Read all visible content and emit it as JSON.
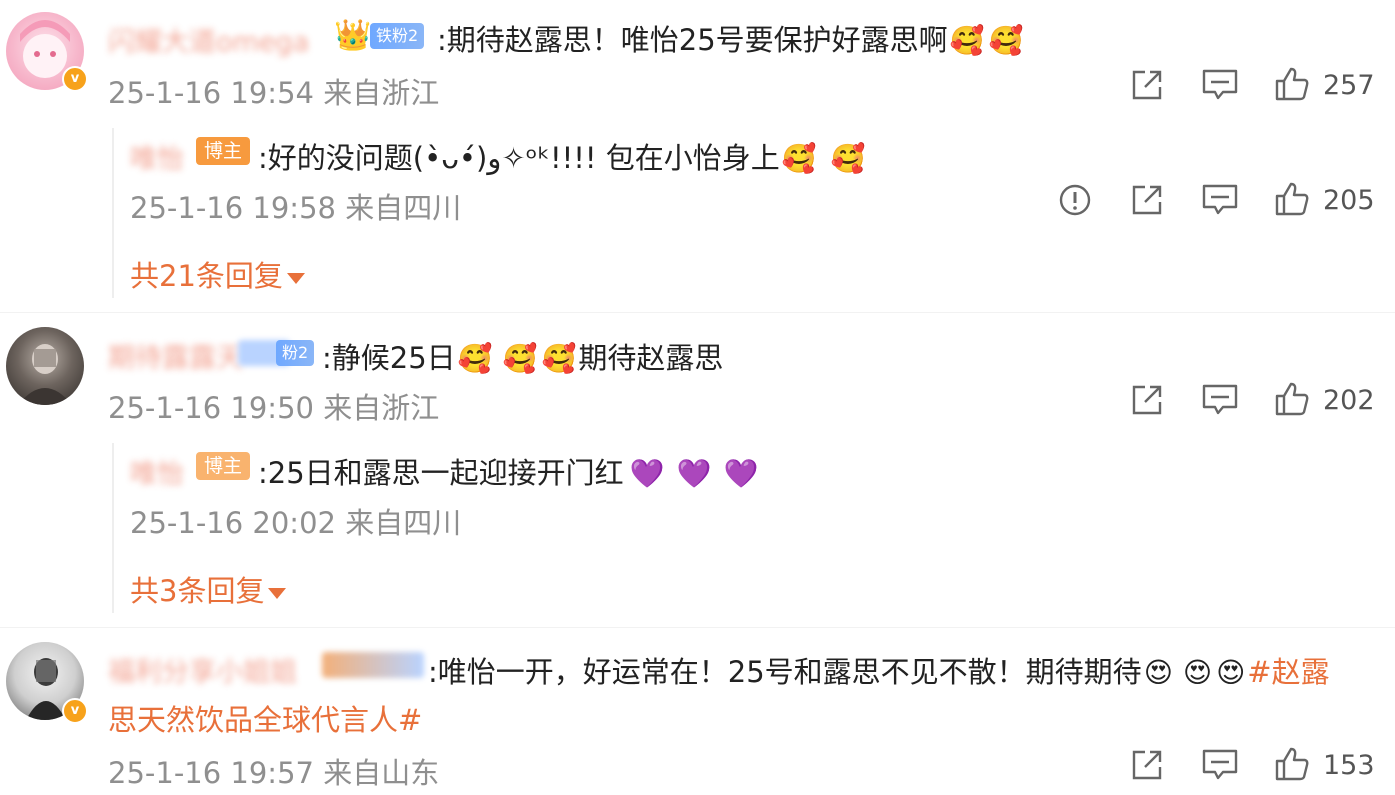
{
  "comments": [
    {
      "username": "闪耀大道omega",
      "fan_badge": "铁粉2",
      "text": ":期待赵露思！唯怡25号要保护好露思啊",
      "emojis": [
        "🥰",
        "🥰"
      ],
      "time": "25-1-16 19:54 来自浙江",
      "likes": "257",
      "reply": {
        "username": "唯怡",
        "badge": "博主",
        "text": ":好的没问题(•̀ᴗ•́)و✧ᵒᵏ!!!! 包在小怡身上",
        "emojis": [
          "🥰",
          "🥰"
        ],
        "time": "25-1-16 19:58 来自四川",
        "likes": "205"
      },
      "more_replies": "共21条回复"
    },
    {
      "username": "期待露露天",
      "fan_badge": "粉2",
      "text": ":静候25日",
      "emojis": [
        "🥰",
        "🥰",
        "🥰"
      ],
      "text_after": "期待赵露思",
      "time": "25-1-16 19:50 来自浙江",
      "likes": "202",
      "reply": {
        "username": "唯怡",
        "badge": "博主",
        "text": ":25日和露思一起迎接开门红",
        "hearts": [
          "💜",
          "💜",
          "💜"
        ],
        "time": "25-1-16 20:02 来自四川"
      },
      "more_replies": "共3条回复"
    },
    {
      "username": "福利分享小姐姐",
      "fan_badge": "粉2",
      "text": ":唯怡一开，好运常在！25号和露思不见不散！期待期待",
      "emojis": [
        "😍",
        "😍",
        "😍"
      ],
      "hashtag_line1": "#赵露",
      "hashtag_line2": "思天然饮品全球代言人#",
      "time": "25-1-16 19:57 来自山东",
      "likes": "153"
    }
  ],
  "icons": {
    "share": "share-icon",
    "comment": "comment-icon",
    "like": "like-icon",
    "report": "report-icon",
    "verified": "verified-icon"
  }
}
